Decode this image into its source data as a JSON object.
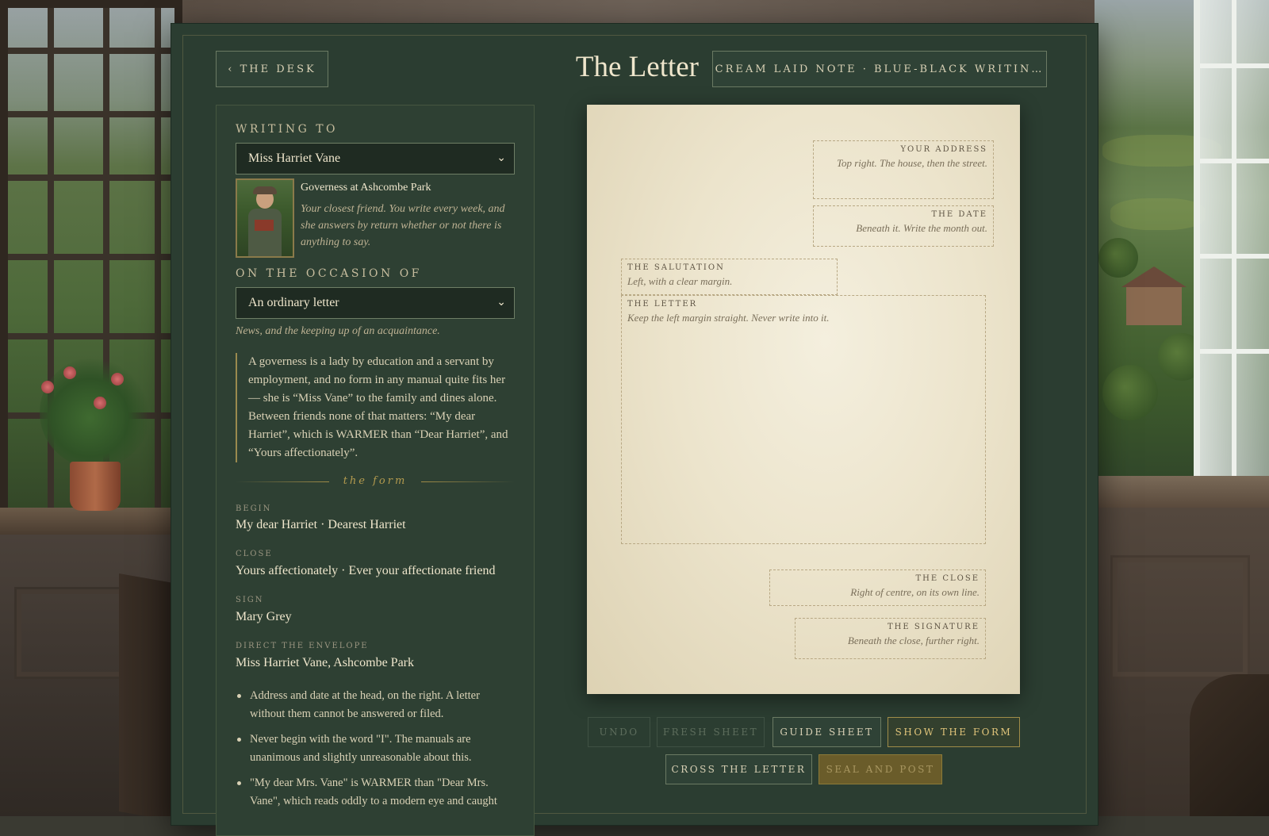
{
  "header": {
    "back_label": "‹ THE DESK",
    "title": "The Letter",
    "paper_label": "CREAM LAID NOTE · BLUE-BLACK WRITIN…"
  },
  "writing_to": {
    "label": "WRITING TO",
    "selected": "Miss Harriet Vane",
    "role": "Governess at Ashcombe Park",
    "description": "Your closest friend. You write every week, and she answers by return whether or not there is anything to say."
  },
  "occasion": {
    "label": "ON THE OCCASION OF",
    "selected": "An ordinary letter",
    "note": "News, and the keeping up of an acquaintance."
  },
  "guidance": "A governess is a lady by education and a servant by employment, and no form in any manual quite fits her — she is “Miss Vane” to the family and dines alone. Between friends none of that matters: “My dear Harriet”, which is WARMER than “Dear Harriet”, and “Yours affectionately”.",
  "form": {
    "divider": "the form",
    "begin_label": "BEGIN",
    "begin": "My dear Harriet · Dearest Harriet",
    "close_label": "CLOSE",
    "close": "Yours affectionately · Ever your affectionate friend",
    "sign_label": "SIGN",
    "sign": "Mary Grey",
    "envelope_label": "DIRECT THE ENVELOPE",
    "envelope": "Miss Harriet Vane, Ashcombe Park"
  },
  "rules": [
    "Address and date at the head, on the right. A letter without them cannot be answered or filed.",
    "Never begin with the word \"I\". The manuals are unanimous and slightly unreasonable about this.",
    "\"My dear Mrs. Vane\" is WARMER than \"Dear Mrs. Vane\", which reads oddly to a modern eye and caught"
  ],
  "sheet": {
    "address": {
      "title": "YOUR ADDRESS",
      "hint": "Top right. The house, then the street."
    },
    "date": {
      "title": "THE DATE",
      "hint": "Beneath it. Write the month out."
    },
    "salutation": {
      "title": "THE SALUTATION",
      "hint": "Left, with a clear margin."
    },
    "body": {
      "title": "THE LETTER",
      "hint": "Keep the left margin straight. Never write into it."
    },
    "close": {
      "title": "THE CLOSE",
      "hint": "Right of centre, on its own line."
    },
    "signature": {
      "title": "THE SIGNATURE",
      "hint": "Beneath the close, further right."
    }
  },
  "actions": {
    "undo": "UNDO",
    "fresh_sheet": "FRESH SHEET",
    "guide_sheet": "GUIDE SHEET",
    "show_form": "SHOW THE FORM",
    "cross_letter": "CROSS THE LETTER",
    "seal_post": "SEAL AND POST"
  }
}
